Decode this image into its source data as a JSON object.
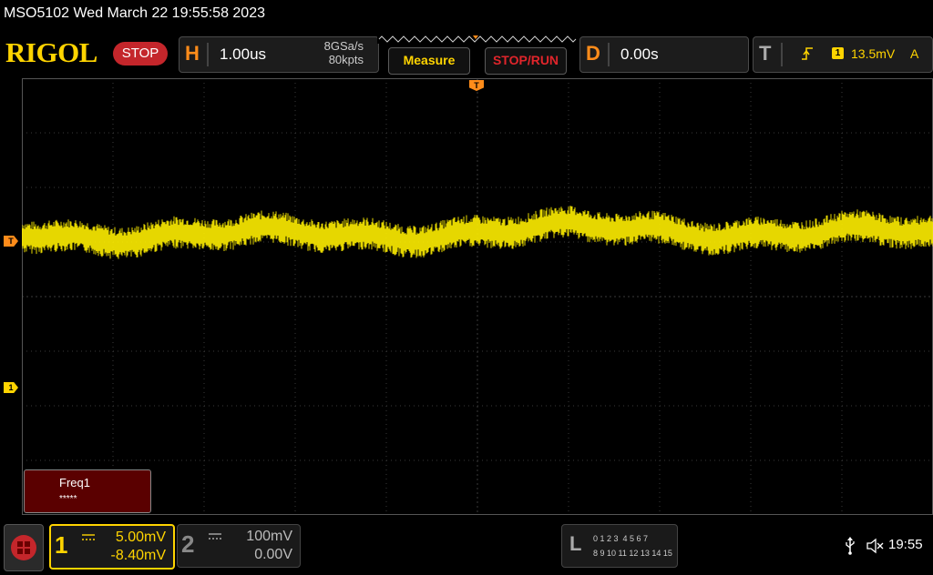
{
  "title_bar": {
    "text": "MSO5102  Wed March 22 19:55:58 2023"
  },
  "brand": {
    "logo": "RIGOL",
    "run_state": "STOP"
  },
  "horizontal": {
    "letter": "H",
    "timebase": "1.00us",
    "sample_rate": "8GSa/s",
    "memory_depth": "80kpts"
  },
  "buttons": {
    "measure": "Measure",
    "stop_run": "STOP/RUN"
  },
  "delay": {
    "letter": "D",
    "value": "0.00s"
  },
  "trigger": {
    "letter": "T",
    "channel": "1",
    "level": "13.5mV",
    "mode": "A"
  },
  "markers": {
    "trigger_top": "T",
    "trigger_left": "T",
    "channel1": "1"
  },
  "measurement": {
    "label": "Freq1",
    "value": "*****"
  },
  "channel1": {
    "number": "1",
    "scale": "5.00mV",
    "offset": "-8.40mV"
  },
  "channel2": {
    "number": "2",
    "scale": "100mV",
    "offset": "0.00V"
  },
  "logic": {
    "letter": "L",
    "row1": "0 1 2 3  4 5 6 7",
    "row2": "8 9 10 11 12 13 14 15"
  },
  "status": {
    "clock": "19:55"
  },
  "colors": {
    "ch1": "#ffd400",
    "trigger": "#ff8c1a",
    "stop": "#c4262b",
    "grid": "#3a3a3a"
  },
  "icons": {
    "usb": "usb-icon",
    "sound": "speaker-muted-icon",
    "home": "menu-grid-icon"
  }
}
